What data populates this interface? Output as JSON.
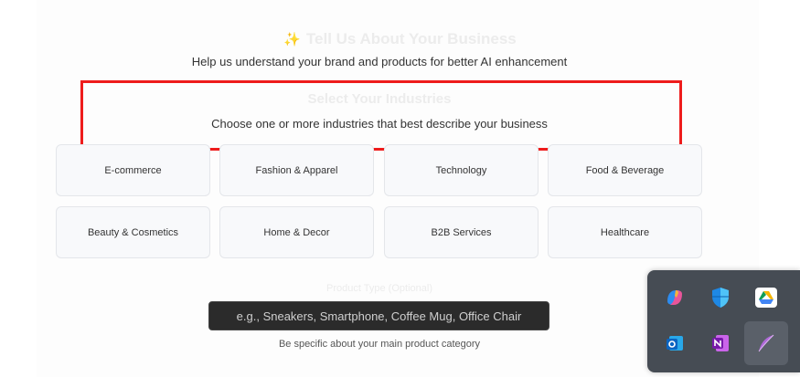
{
  "header": {
    "title": "Tell Us About Your Business",
    "subtitle": "Help us understand your brand and products for better AI enhancement"
  },
  "industries": {
    "title": "Select Your Industries",
    "description": "Choose one or more industries that best describe your business",
    "options": [
      "E-commerce",
      "Fashion & Apparel",
      "Technology",
      "Food & Beverage",
      "Beauty & Cosmetics",
      "Home & Decor",
      "B2B Services",
      "Healthcare"
    ]
  },
  "product": {
    "label": "Product Type (Optional)",
    "placeholder": "e.g., Sneakers, Smartphone, Coffee Mug, Office Chair",
    "help": "Be specific about your main product category"
  },
  "tray": {
    "icons": [
      "copilot-icon",
      "defender-icon",
      "google-drive-icon",
      "outlook-icon",
      "onenote-icon",
      "feather-pen-icon"
    ]
  },
  "colors": {
    "highlight": "#ee1c1c",
    "tray_bg": "#464c54"
  }
}
